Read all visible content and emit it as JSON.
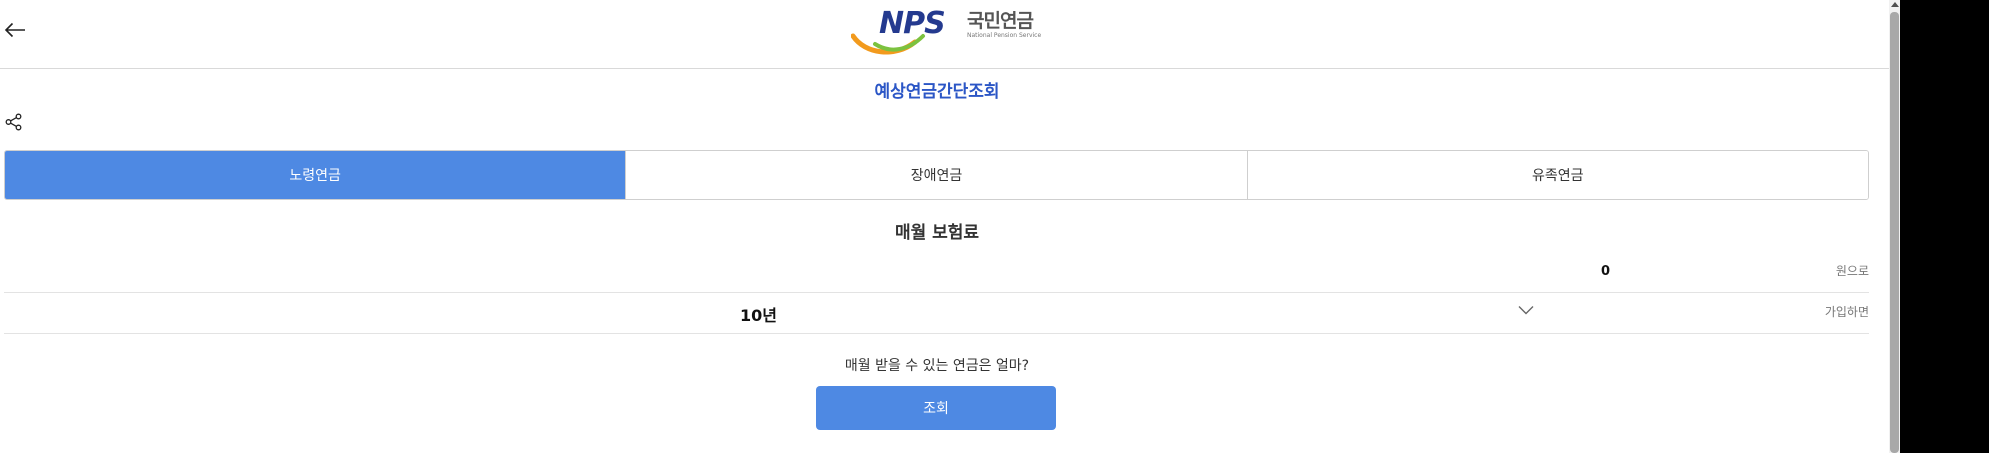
{
  "header": {
    "back_icon": "arrow-left-icon",
    "logo": {
      "letters": "NPS",
      "korean": "국민연금",
      "english": "National Pension Service",
      "colors": {
        "navy": "#243a8f",
        "green": "#7cc23f",
        "orange": "#f29a1d"
      }
    }
  },
  "page": {
    "title": "예상연금간단조회",
    "share_icon": "share-icon"
  },
  "tabs": [
    {
      "label": "노령연금",
      "active": true
    },
    {
      "label": "장애연금",
      "active": false
    },
    {
      "label": "유족연금",
      "active": false
    }
  ],
  "form": {
    "section_title": "매월 보험료",
    "amount": {
      "value": "0",
      "unit": "원으로"
    },
    "period": {
      "value": "10년",
      "unit": "가입하면",
      "icon": "chevron-down-icon"
    },
    "question": "매월 받을 수 있는 연금은 얼마?",
    "submit_label": "조회"
  },
  "colors": {
    "accent": "#4e89e3",
    "title": "#2b56c6"
  }
}
